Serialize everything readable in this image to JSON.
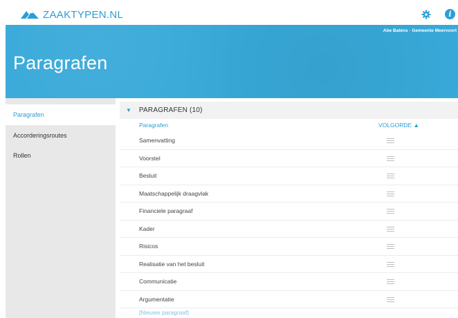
{
  "app": {
    "logo_text": "ZAAKTYPEN.NL",
    "user_line": "Abe Batens · Gemeente Meervoort",
    "accent_color": "#2a9fd6",
    "hero_color": "#38a9d9"
  },
  "header": {
    "title": "Paragrafen",
    "icons": [
      "gear-icon",
      "info-icon"
    ],
    "info_glyph": "i"
  },
  "sidebar": {
    "items": [
      {
        "label": "Paragrafen",
        "active": true
      },
      {
        "label": "Accorderingsroutes",
        "active": false
      },
      {
        "label": "Rollen",
        "active": false
      }
    ]
  },
  "main": {
    "section_caret": "▼",
    "section_title": "PARAGRAFEN (10)",
    "columns": {
      "name": "Paragrafen",
      "order": "VOLGORDE ▲"
    },
    "rows": [
      "Samenvatting",
      "Voorstel",
      "Besluit",
      "Maatschappelijk draagvlak",
      "Financiele paragraaf",
      "Kader",
      "Risicos",
      "Realisatie van het besluit",
      "Communicatie",
      "Argumentatie"
    ],
    "new_link": "[Nieuwe paragraaf]"
  }
}
